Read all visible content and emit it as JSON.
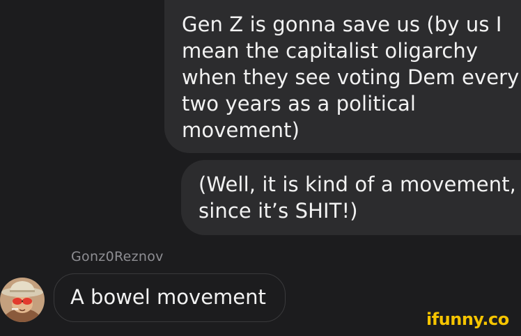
{
  "messages": [
    {
      "lines": [
        "Gen Z is gonna save us (by us I",
        "mean the capitalist oligarchy",
        "when they see voting Dem every",
        "two years as a political",
        "movement)"
      ]
    },
    {
      "lines": [
        "(Well, it is kind of a movement,",
        "since it’s SHIT!)"
      ]
    }
  ],
  "reply": {
    "sender": "Gonz0Reznov",
    "text": "A bowel movement",
    "avatar": "user-avatar-cowboy-hat-sunglasses"
  },
  "watermark": {
    "text": "ifunny.co",
    "color": "#f5c400"
  },
  "colors": {
    "background": "#1c1c1e",
    "bubble": "#2c2c2e",
    "sender": "#8e8e93"
  }
}
